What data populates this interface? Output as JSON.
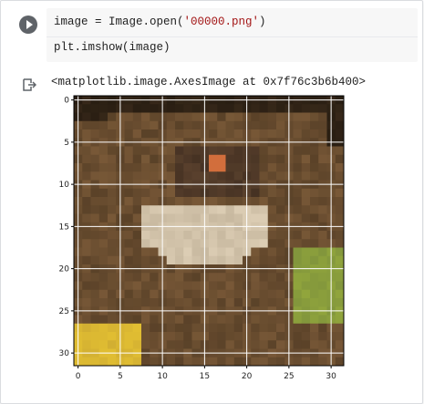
{
  "code": {
    "line1_prefix": "image = Image.open(",
    "line1_string": "'00000.png'",
    "line1_suffix": ")",
    "line2": "plt.imshow(image)"
  },
  "output": {
    "text": "<matplotlib.image.AxesImage at 0x7f76c3b6b400>"
  },
  "chart_data": {
    "type": "heatmap",
    "title": "",
    "xlabel": "",
    "ylabel": "",
    "xlim": [
      -0.5,
      31.5
    ],
    "ylim": [
      31.5,
      -0.5
    ],
    "xticks": [
      0,
      5,
      10,
      15,
      20,
      25,
      30
    ],
    "yticks": [
      0,
      5,
      10,
      15,
      20,
      25,
      30
    ],
    "grid": true,
    "description_colors": {
      "background": "#7a5a3a",
      "dark": "#2e1e14",
      "light": "#e8dcc4",
      "green": "#7f9a3a",
      "yellow": "#d4b030",
      "orange": "#d26a3a"
    }
  }
}
